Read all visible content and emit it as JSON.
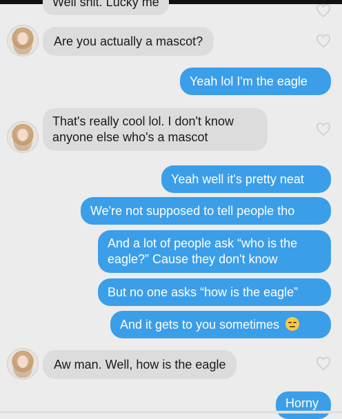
{
  "conversation": {
    "messages": [
      {
        "from": "them",
        "text": "Well shit. Lucky me"
      },
      {
        "from": "them",
        "text": "Are you actually a mascot?"
      },
      {
        "from": "me",
        "text": "Yeah lol I'm the eagle"
      },
      {
        "from": "them",
        "line1": "That's really cool lol. I don't know",
        "line2": "anyone else who's a mascot"
      },
      {
        "from": "me",
        "text": "Yeah well it's pretty neat"
      },
      {
        "from": "me",
        "text": "We're not supposed to tell people tho"
      },
      {
        "from": "me",
        "line1": "And a lot of people ask “who is the",
        "line2": "eagle?” Cause they don't know"
      },
      {
        "from": "me",
        "text": "But no one asks “how is the eagle”"
      },
      {
        "from": "me",
        "text": "And it gets to you sometimes",
        "emoji": "pensive-face-emoji"
      },
      {
        "from": "them",
        "text": "Aw man. Well, how is the eagle"
      },
      {
        "from": "me",
        "text": "Horny"
      }
    ]
  },
  "colors": {
    "sent_bubble": "#3b9ee9",
    "received_bubble": "#dcdcdc",
    "background": "#ececec"
  },
  "icons": {
    "avatar": "contact-avatar",
    "like": "heart-icon",
    "emoji": "pensive-face-emoji"
  }
}
